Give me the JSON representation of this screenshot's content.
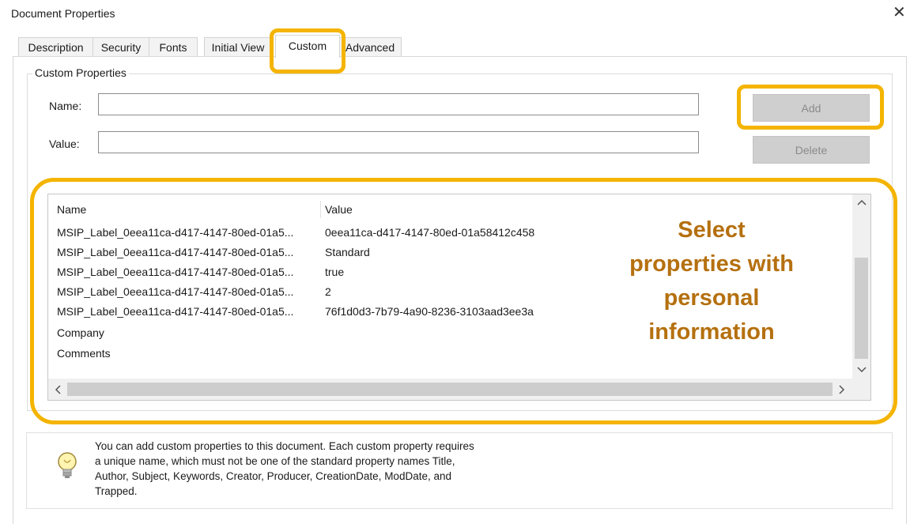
{
  "window": {
    "title": "Document Properties",
    "close_symbol": "✕"
  },
  "tabs": [
    {
      "label": "Description"
    },
    {
      "label": "Security"
    },
    {
      "label": "Fonts"
    },
    {
      "label": "Initial View"
    },
    {
      "label": "Custom",
      "active": true
    },
    {
      "label": "Advanced"
    }
  ],
  "custom_properties": {
    "group_label": "Custom Properties",
    "name_label": "Name:",
    "name_value": "",
    "value_label": "Value:",
    "value_value": "",
    "add_button": "Add",
    "delete_button": "Delete"
  },
  "list": {
    "columns": [
      "Name",
      "Value"
    ],
    "rows": [
      {
        "name": "MSIP_Label_0eea11ca-d417-4147-80ed-01a5...",
        "value": "0eea11ca-d417-4147-80ed-01a58412c458"
      },
      {
        "name": "MSIP_Label_0eea11ca-d417-4147-80ed-01a5...",
        "value": "Standard"
      },
      {
        "name": "MSIP_Label_0eea11ca-d417-4147-80ed-01a5...",
        "value": "true"
      },
      {
        "name": "MSIP_Label_0eea11ca-d417-4147-80ed-01a5...",
        "value": "2"
      },
      {
        "name": "MSIP_Label_0eea11ca-d417-4147-80ed-01a5...",
        "value": "76f1d0d3-7b79-4a90-8236-3103aad3ee3a"
      },
      {
        "name": "Company",
        "value": ""
      },
      {
        "name": "Comments",
        "value": ""
      }
    ]
  },
  "callout": {
    "line1": "Select",
    "line2": "properties with",
    "line3": "personal",
    "line4": "information"
  },
  "info": {
    "line1": "You can add custom properties to this document. Each custom property requires",
    "line2": "a unique name, which must not be one of the standard property names Title,",
    "line3": "Author, Subject, Keywords, Creator, Producer, CreationDate, ModDate, and",
    "line4": "Trapped."
  },
  "colors": {
    "highlight": "#f4b400",
    "callout_text": "#b5700f"
  },
  "icons": [
    "close-icon",
    "lightbulb-icon",
    "scroll-up-icon",
    "scroll-down-icon",
    "scroll-left-icon",
    "scroll-right-icon"
  ]
}
